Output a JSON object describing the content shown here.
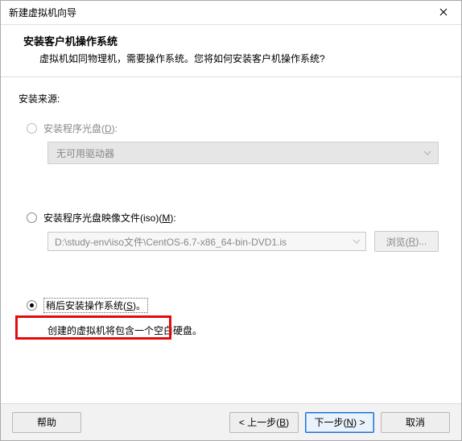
{
  "window": {
    "title": "新建虚拟机向导"
  },
  "header": {
    "title": "安装客户机操作系统",
    "desc": "虚拟机如同物理机，需要操作系统。您将如何安装客户机操作系统?"
  },
  "body": {
    "source_label": "安装来源:",
    "disc": {
      "label_pre": "安装程序光盘(",
      "hotkey": "D",
      "label_post": "):",
      "drive_text": "无可用驱动器"
    },
    "iso": {
      "label_pre": "安装程序光盘映像文件(iso)(",
      "hotkey": "M",
      "label_post": "):",
      "path": "D:\\study-env\\iso文件\\CentOS-6.7-x86_64-bin-DVD1.is",
      "browse_pre": "浏览(",
      "browse_hotkey": "R",
      "browse_post": ")..."
    },
    "later": {
      "label_pre": "稍后安装操作系统(",
      "hotkey": "S",
      "label_post": ")。",
      "note": "创建的虚拟机将包含一个空白硬盘。"
    }
  },
  "footer": {
    "help": "帮助",
    "back_pre": "< 上一步(",
    "back_hotkey": "B",
    "back_post": ")",
    "next_pre": "下一步(",
    "next_hotkey": "N",
    "next_post": ") >",
    "cancel": "取消"
  }
}
